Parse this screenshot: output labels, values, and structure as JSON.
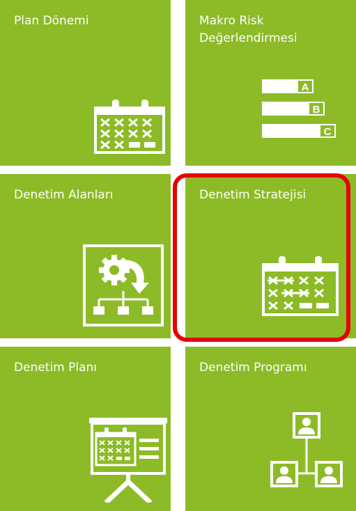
{
  "tiles": [
    {
      "label": "Plan Dönemi",
      "icon": "calendar-x-icon"
    },
    {
      "label": "Makro Risk Değerlendirmesi",
      "icon": "abc-bars-icon",
      "bars": [
        "A",
        "B",
        "C"
      ]
    },
    {
      "label": "Denetim Alanları",
      "icon": "gear-hierarchy-icon"
    },
    {
      "label": "Denetim Stratejisi",
      "icon": "calendar-arrows-icon",
      "selected": true
    },
    {
      "label": "Denetim Planı",
      "icon": "presentation-board-icon"
    },
    {
      "label": "Denetim Programı",
      "icon": "people-org-chart-icon"
    }
  ],
  "colors": {
    "tile": "#8cbb27",
    "highlight": "#e60000",
    "icon": "#ffffff"
  }
}
